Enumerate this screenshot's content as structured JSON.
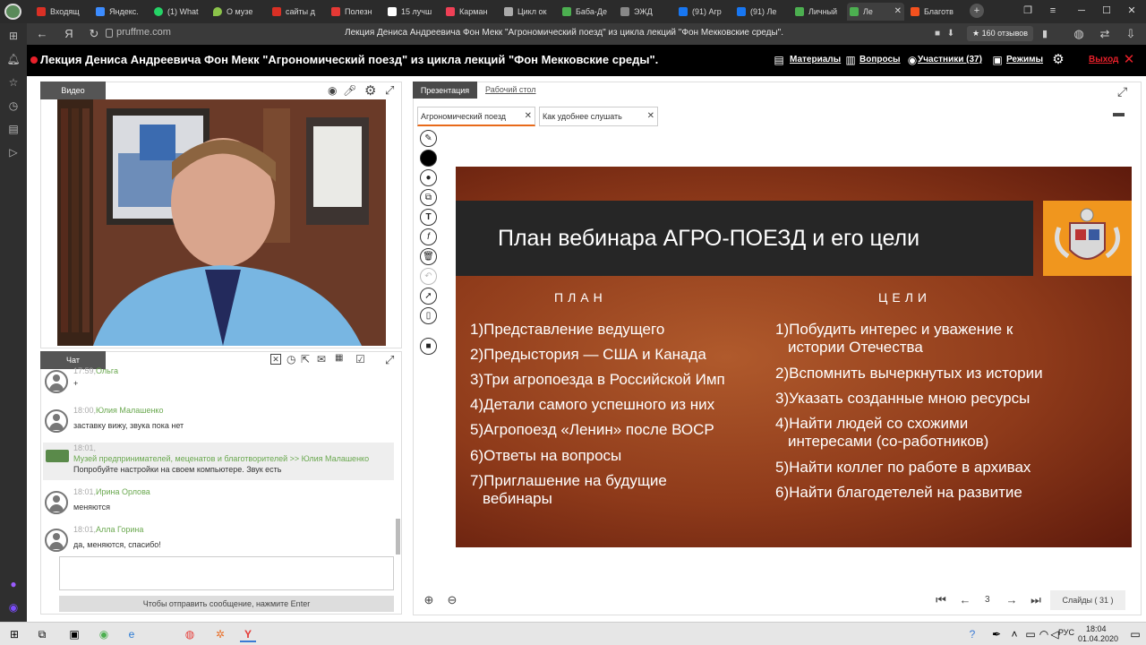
{
  "browser": {
    "tabs": [
      {
        "label": "Входящ",
        "color": "#d93025"
      },
      {
        "label": "Яндекс.",
        "color": "#3c8cff"
      },
      {
        "label": "(1) What",
        "color": "#25d366"
      },
      {
        "label": "О музе",
        "color": "#8bc34a"
      },
      {
        "label": "сайты д",
        "color": "#d93025"
      },
      {
        "label": "Полезн",
        "color": "#e53935"
      },
      {
        "label": "15 лучш",
        "color": "#ffffff"
      },
      {
        "label": "Карман",
        "color": "#ef4056"
      },
      {
        "label": "Цикл ок",
        "color": "#aaaaaa"
      },
      {
        "label": "Баба-Де",
        "color": "#4caf50"
      },
      {
        "label": "ЭЖД",
        "color": "#888888"
      },
      {
        "label": "(91) Агр",
        "color": "#1877f2"
      },
      {
        "label": "(91) Ле",
        "color": "#1877f2"
      },
      {
        "label": "Личный",
        "color": "#4caf50"
      },
      {
        "label": "Ле",
        "color": "#4caf50"
      },
      {
        "label": "Благотв",
        "color": "#f4511e"
      }
    ],
    "url": "pruffme.com",
    "page_title": "Лекция Дениса Андреевича Фон Мекк \"Агрономический поезд\" из цикла лекций \"Фон Мекковские среды\".",
    "reviews": "★ 160 отзывов"
  },
  "header": {
    "title": "Лекция Дениса Андреевича Фон Мекк \"Агрономический поезд\" из цикла лекций \"Фон Мекковские среды\".",
    "materials": "Материалы",
    "questions": "Вопросы",
    "participants": "Участники (37)",
    "modes": "Режимы",
    "exit": "Выход"
  },
  "video": {
    "tab": "Видео"
  },
  "chat": {
    "tab": "Чат",
    "messages": [
      {
        "time": "17:59,",
        "name": "Ольга",
        "text": "+"
      },
      {
        "time": "18:00,",
        "name": "Юлия Малашенко",
        "text": "заставку вижу, звука пока нет"
      },
      {
        "time": "18:01,",
        "name": "Музей предпринимателей, меценатов и благотворителей >> Юлия Малашенко",
        "text": "Попробуйте настройки на своем компьютере. Звук есть"
      },
      {
        "time": "18:01,",
        "name": "Ирина Орлова",
        "text": "меняются"
      },
      {
        "time": "18:01,",
        "name": "Алла Горина",
        "text": "да, меняются, спасибо!"
      }
    ],
    "send_hint": "Чтобы отправить сообщение, нажмите Enter"
  },
  "presentation": {
    "tab_presentation": "Презентация",
    "tab_desktop": "Рабочий стол",
    "files": [
      "Агрономический поезд",
      "Как удобнее слушать"
    ],
    "current_slide": "3",
    "slides_total": "Слайды ( 31 )"
  },
  "slide": {
    "title": "План вебинара АГРО-ПОЕЗД и его цели",
    "plan_heading": "ПЛАН",
    "goals_heading": "ЦЕЛИ",
    "plan": [
      "1)Представление ведущего",
      "2)Предыстория — США и Канада",
      "3)Три агропоезда в Российской Имп",
      "4)Детали самого успешного из них",
      "5)Агропоезд «Ленин» после ВОСР",
      "6)Ответы на вопросы",
      "7)Приглашение на будущие",
      "вебинары"
    ],
    "goals": [
      "1)Побудить интерес и уважение к",
      "истории Отечества",
      "2)Вспомнить вычеркнутых из истории",
      "3)Указать созданные мною ресурсы",
      "4)Найти людей со схожими",
      "интересами (со-работников)",
      "5)Найти коллег по работе в архивах",
      "6)Найти благодетелей на развитие"
    ]
  },
  "taskbar": {
    "lang": "РУС",
    "time": "18:04",
    "date": "01.04.2020"
  }
}
